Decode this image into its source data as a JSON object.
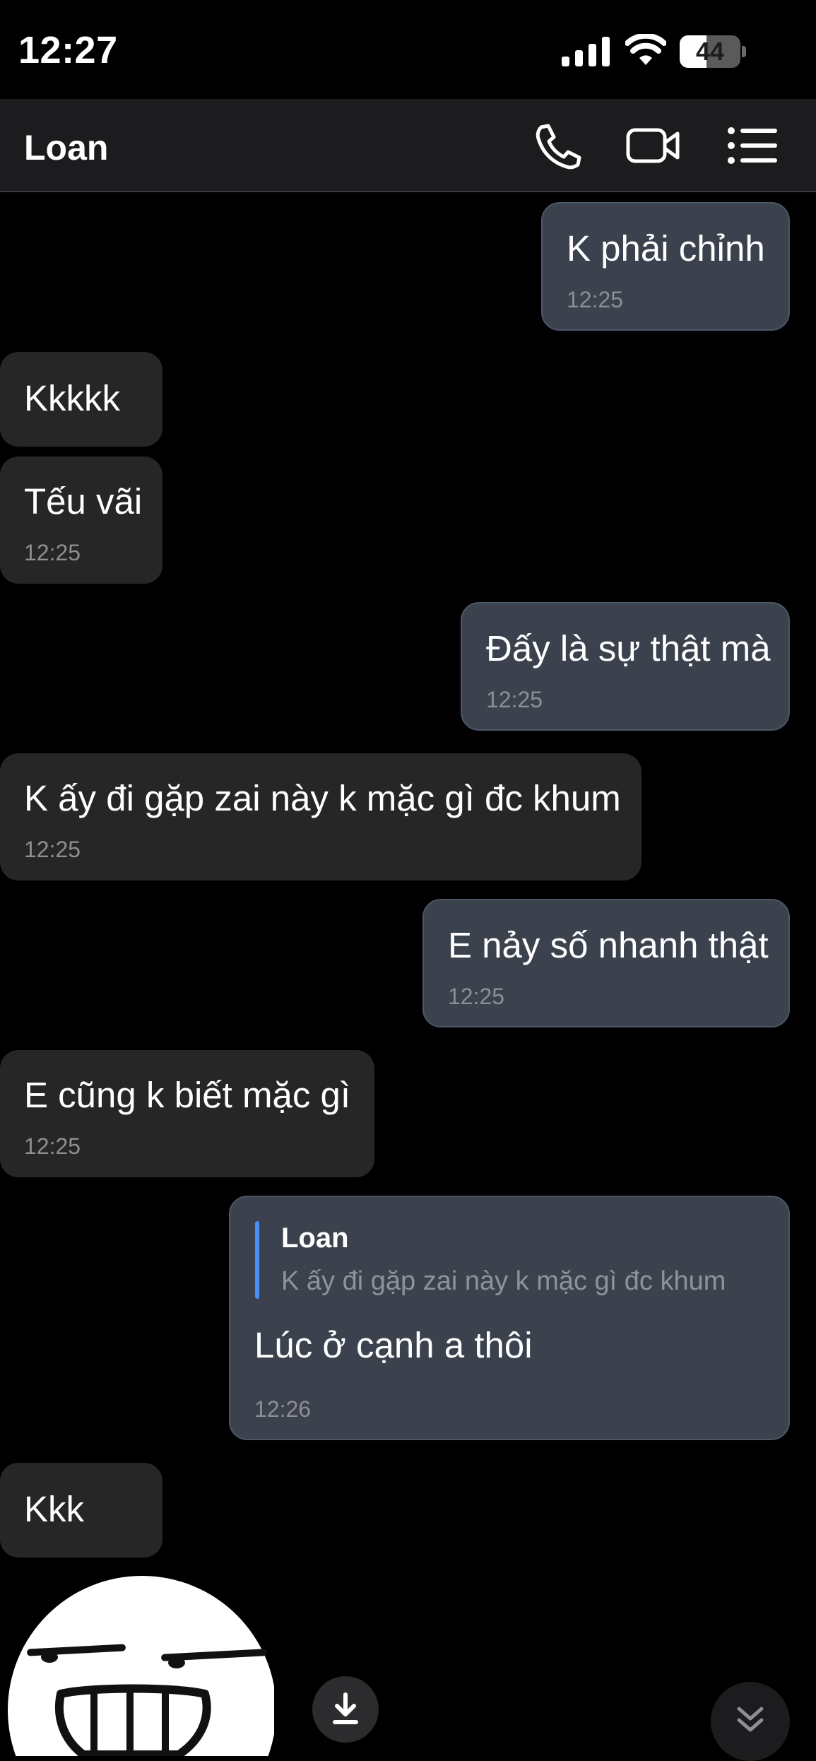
{
  "status_bar": {
    "time": "12:27",
    "battery": "44",
    "battery_level": 0.44
  },
  "header": {
    "title": "Loan",
    "icons": [
      "phone-icon",
      "video-camera-icon",
      "menu-list-icon"
    ]
  },
  "messages": [
    {
      "direction": "outgoing",
      "text": "K phải chỉnh",
      "time": "12:25"
    },
    {
      "direction": "incoming",
      "text": "Kkkkk"
    },
    {
      "direction": "incoming",
      "text": "Tếu vãi",
      "time": "12:25"
    },
    {
      "direction": "outgoing",
      "text": "Đấy là sự thật mà",
      "time": "12:25"
    },
    {
      "direction": "incoming",
      "text": "K ấy đi gặp zai này k mặc gì đc khum",
      "time": "12:25"
    },
    {
      "direction": "outgoing",
      "text": "E nảy số nhanh thật",
      "time": "12:25"
    },
    {
      "direction": "incoming",
      "text": "E cũng k biết mặc gì",
      "time": "12:25"
    },
    {
      "direction": "outgoing",
      "reply_to": {
        "author": "Loan",
        "text": "K ấy đi gặp zai này k mặc gì đc khum"
      },
      "text": "Lúc ở cạnh a thôi",
      "time": "12:26"
    },
    {
      "direction": "incoming",
      "text": "Kkk"
    },
    {
      "direction": "incoming",
      "type": "sticker",
      "sticker": "grinning-face-sticker"
    }
  ],
  "floating_buttons": [
    "download-icon",
    "scroll-down-icon"
  ]
}
